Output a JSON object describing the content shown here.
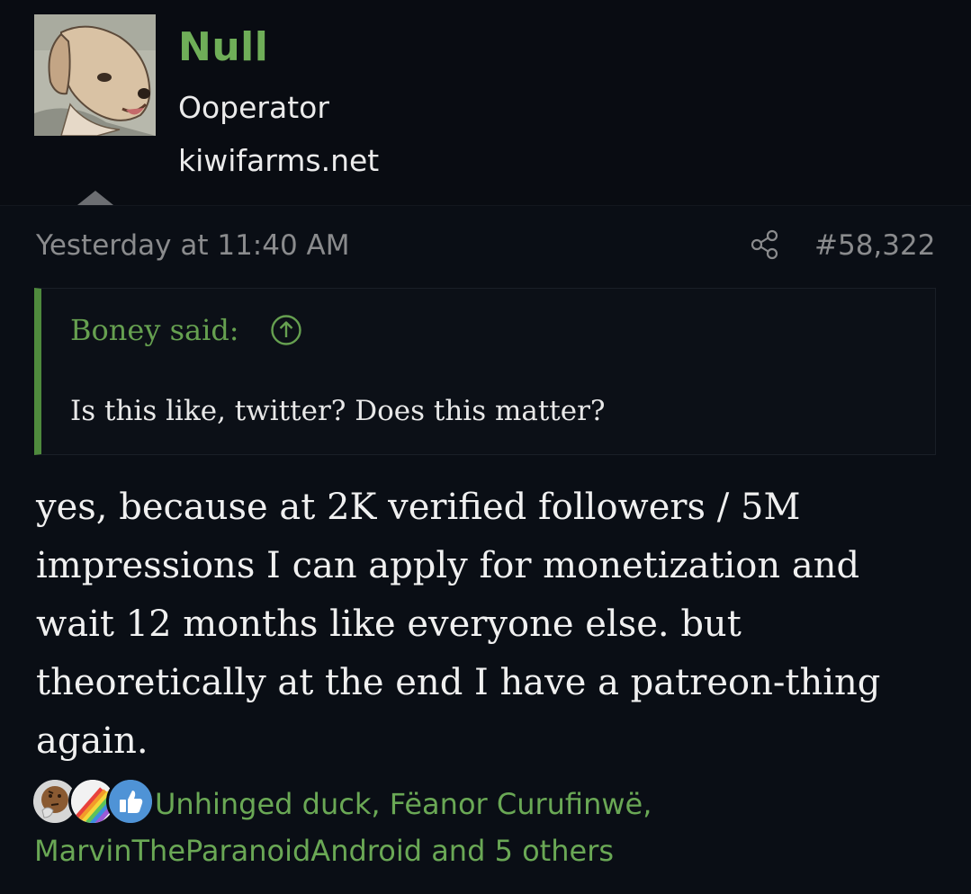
{
  "user": {
    "name": "Null",
    "title": "Ooperator",
    "site": "kiwifarms.net"
  },
  "post": {
    "date": "Yesterday at 11:40 AM",
    "number": "#58,322",
    "quote": {
      "author": "Boney said:",
      "text": "Is this like, twitter? Does this matter?"
    },
    "body_lines": [
      "yes, because at 2K verified followers / 5M",
      "impressions I can apply for monetization and",
      "wait 12 months like everyone else. but",
      "theoretically at the end I have a patreon-thing",
      "again."
    ]
  },
  "reactions": {
    "icons": [
      "thinking-face-icon",
      "rainbow-icon",
      "thumbs-up-icon"
    ],
    "reactors_line": "Unhinged duck, Fëanor Curufinwë, MarvinTheParanoidAndroid and 5 others"
  },
  "colors": {
    "background": "#090c12",
    "username": "#6fae58",
    "quote_bar": "#4f8a3d",
    "link": "#6aa855",
    "meta": "#8a8b8d"
  }
}
